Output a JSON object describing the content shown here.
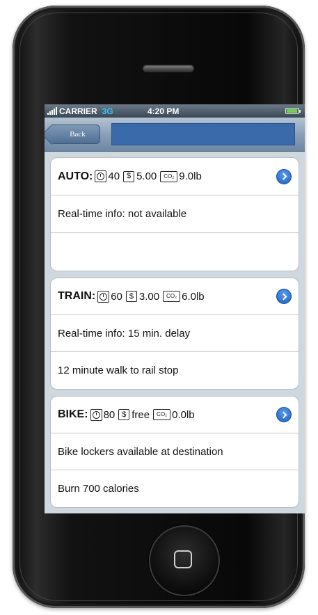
{
  "status_bar": {
    "carrier": "CARRIER",
    "network": "3G",
    "time": "4:20 PM"
  },
  "nav": {
    "back_label": "Back",
    "title": ""
  },
  "options": [
    {
      "mode": "AUTO:",
      "time": "40",
      "cost": "5.00",
      "co2": "9.0lb",
      "details": [
        "Real-time info:  not available",
        ""
      ]
    },
    {
      "mode": "TRAIN:",
      "time": "60",
      "cost": "3.00",
      "co2": "6.0lb",
      "details": [
        "Real-time info: 15 min. delay",
        "12 minute walk to rail stop"
      ]
    },
    {
      "mode": "BIKE:",
      "time": "80",
      "cost": "free",
      "co2": "0.0lb",
      "details": [
        "Bike lockers available at destination",
        "Burn 700 calories"
      ]
    }
  ],
  "icons": {
    "time": "clock-icon",
    "cost": "dollar-icon",
    "co2": "co2-icon",
    "disclosure": "chevron-right-icon"
  },
  "colors": {
    "title_bar": "#3b6aab",
    "disclosure": "#2a6fd1",
    "battery": "#6fd44b",
    "network": "#38c7ff"
  }
}
